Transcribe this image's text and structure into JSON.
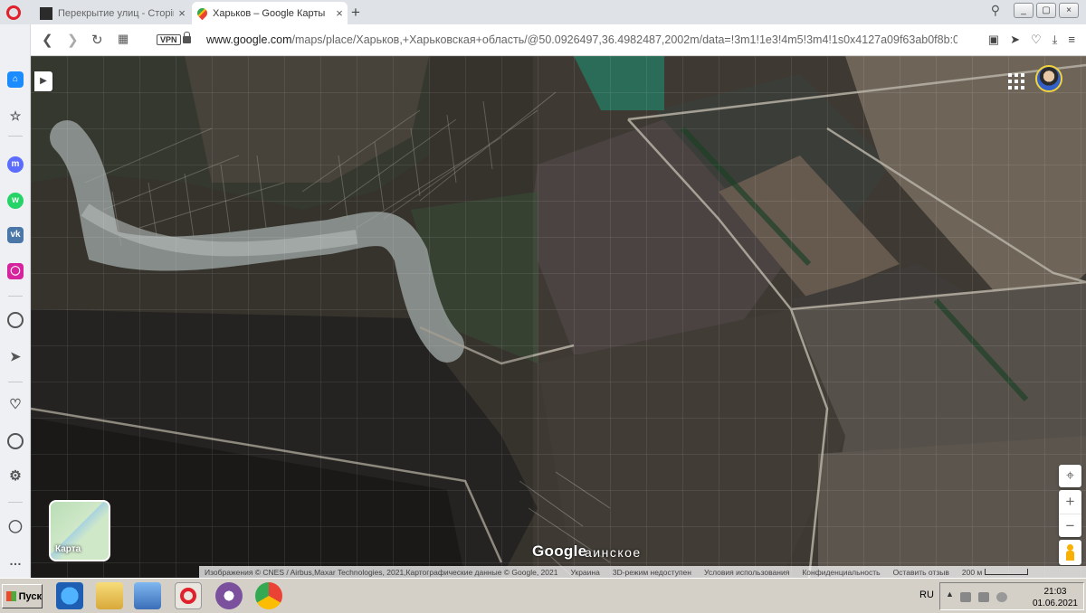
{
  "browser": {
    "tabs": [
      {
        "title": "Перекрытие улиц - Сторінка",
        "icon": "page-icon",
        "active": false
      },
      {
        "title": "Харьков – Google Карты",
        "icon": "google-maps-icon",
        "active": true
      }
    ],
    "new_tab": "+",
    "address": {
      "vpn": "VPN",
      "host": "www.google.com",
      "path": "/maps/place/Харьков,+Харьковская+область/@50.0926497,36.4982487,2002m/data=!3m1!1e3!4m5!3m4!1s0x4127a09f63ab0f8b:0:"
    }
  },
  "map": {
    "layer_label": "Карта",
    "logo": "Google",
    "place_fragment": "аинское",
    "attribution": [
      "Изображения © CNES / Airbus,Maxar Technologies, 2021,Картографические данные © Google, 2021",
      "Украина",
      "3D-режим недоступен",
      "Условия использования",
      "Конфиденциальность",
      "Оставить отзыв"
    ],
    "scale": "200 м",
    "zoom_in": "+",
    "zoom_out": "−"
  },
  "taskbar": {
    "start": "Пуск",
    "lang": "RU",
    "time": "21:03",
    "date": "01.06.2021"
  },
  "colors": {
    "opera_red": "#e0202a",
    "accent_blue": "#1a73e8"
  }
}
